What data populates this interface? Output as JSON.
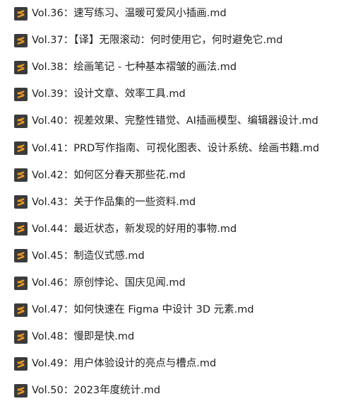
{
  "colors": {
    "icon_background": "#3b3b3b",
    "icon_accent": "#f29b1d",
    "text": "#1f1f1f"
  },
  "files": [
    {
      "name": "Vol.36：速写练习、温暖可爱风小插画.md",
      "icon": "sublime-text-file-icon"
    },
    {
      "name": "Vol.37：【译】无限滚动：何时使用它，何时避免它.md",
      "icon": "sublime-text-file-icon"
    },
    {
      "name": "Vol.38：绘画笔记 - 七种基本褶皱的画法.md",
      "icon": "sublime-text-file-icon"
    },
    {
      "name": "Vol.39：设计文章、效率工具.md",
      "icon": "sublime-text-file-icon"
    },
    {
      "name": "Vol.40：视差效果、完整性错觉、AI插画模型、编辑器设计.md",
      "icon": "sublime-text-file-icon"
    },
    {
      "name": "Vol.41：PRD写作指南、可视化图表、设计系统、绘画书籍.md",
      "icon": "sublime-text-file-icon"
    },
    {
      "name": "Vol.42：如何区分春天那些花.md",
      "icon": "sublime-text-file-icon"
    },
    {
      "name": "Vol.43：关于作品集的一些资料.md",
      "icon": "sublime-text-file-icon"
    },
    {
      "name": "Vol.44：最近状态，新发现的好用的事物.md",
      "icon": "sublime-text-file-icon"
    },
    {
      "name": "Vol.45：制造仪式感.md",
      "icon": "sublime-text-file-icon"
    },
    {
      "name": "Vol.46：原创悖论、国庆见闻.md",
      "icon": "sublime-text-file-icon"
    },
    {
      "name": "Vol.47：如何快速在 Figma 中设计 3D 元素.md",
      "icon": "sublime-text-file-icon"
    },
    {
      "name": "Vol.48：慢即是快.md",
      "icon": "sublime-text-file-icon"
    },
    {
      "name": "Vol.49：用户体验设计的亮点与槽点.md",
      "icon": "sublime-text-file-icon"
    },
    {
      "name": "Vol.50：2023年度统计.md",
      "icon": "sublime-text-file-icon"
    }
  ]
}
